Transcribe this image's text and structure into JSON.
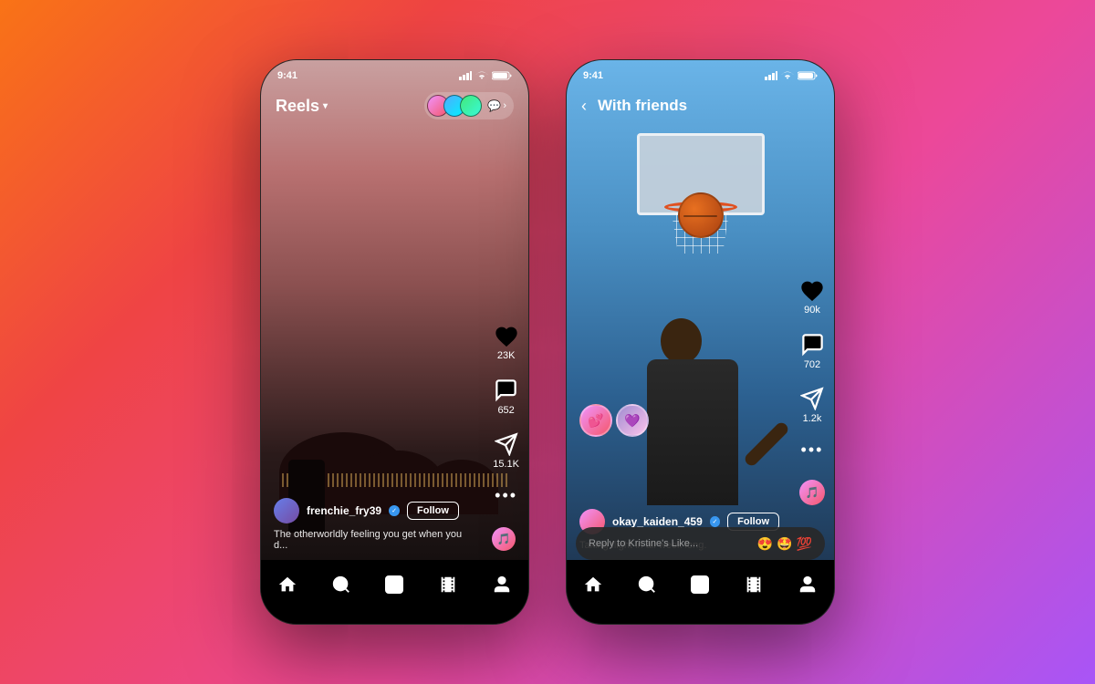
{
  "background": {
    "gradient_start": "#f97316",
    "gradient_end": "#a855f7"
  },
  "phone1": {
    "status_bar": {
      "time": "9:41",
      "signal": "▲▲▲",
      "wifi": "wifi",
      "battery": "battery"
    },
    "top_bar": {
      "title": "Reels",
      "title_chevron": "▾",
      "chat_icon": "💬"
    },
    "actions": {
      "likes": "23K",
      "comments": "652",
      "shares": "15.1K"
    },
    "video_info": {
      "username": "frenchie_fry39",
      "follow_label": "Follow",
      "caption": "The otherworldly feeling you get when you d..."
    },
    "bottom_nav": {
      "home": "⌂",
      "search": "🔍",
      "add": "⊕",
      "reels": "▶",
      "profile": "👤"
    }
  },
  "phone2": {
    "status_bar": {
      "time": "9:41"
    },
    "top_bar": {
      "back_arrow": "‹",
      "title": "With friends"
    },
    "actions": {
      "likes": "90k",
      "comments": "702",
      "shares": "1.2k"
    },
    "video_info": {
      "username": "okay_kaiden_459",
      "follow_label": "Follow",
      "caption": "Taking flight in all week long."
    },
    "reply_bar": {
      "placeholder": "Reply to Kristine's Like...",
      "emojis": [
        "😍",
        "🤩",
        "💯"
      ]
    }
  }
}
